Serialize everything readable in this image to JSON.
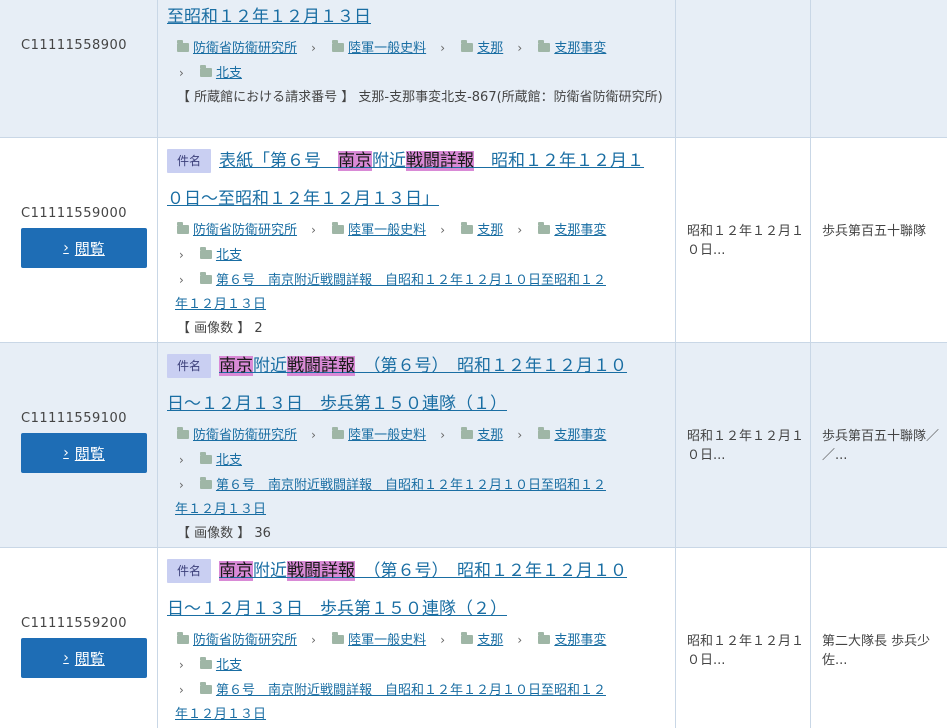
{
  "rows": [
    {
      "ref": "C11111558900",
      "title_lines": [
        "至昭和１２年１２月１３日"
      ],
      "crumbs": [
        "防衛省防衛研究所",
        "陸軍一般史料",
        "支那",
        "支那事変",
        "北支"
      ],
      "meta": "【 所蔵館における請求番号 】 支那-支那事変北支-867(所蔵館：防衛省防衛研究所)"
    },
    {
      "ref": "C11111559000",
      "badge": "件名",
      "view_label": "閲覧",
      "title": {
        "pre": "表紙「第６号　",
        "h1": "南京",
        "mid": "附近",
        "h2": "戦闘詳報",
        "post1": "　昭和１２年１２月１",
        "line2": "０日～至昭和１２年１２月１３日」"
      },
      "crumbs": [
        "防衛省防衛研究所",
        "陸軍一般史料",
        "支那",
        "支那事変",
        "北支"
      ],
      "crumb_last_1": "第６号　南京附近戦闘詳報　自昭和１２年１２月１０日至昭和１２",
      "crumb_last_2": "年１２月１３日",
      "meta": "【 画像数 】 2",
      "date": "昭和１２年１２月１０日...",
      "org": "歩兵第百五十聯隊"
    },
    {
      "ref": "C11111559100",
      "badge": "件名",
      "view_label": "閲覧",
      "title": {
        "pre": "",
        "h1": "南京",
        "mid": "附近",
        "h2": "戦闘詳報",
        "post1": "　（第６号）　昭和１２年１２月１０",
        "line2": "日～１２月１３日　歩兵第１５０連隊（１）"
      },
      "crumbs": [
        "防衛省防衛研究所",
        "陸軍一般史料",
        "支那",
        "支那事変",
        "北支"
      ],
      "crumb_last_1": "第６号　南京附近戦闘詳報　自昭和１２年１２月１０日至昭和１２",
      "crumb_last_2": "年１２月１３日",
      "meta": "【 画像数 】 36",
      "date": "昭和１２年１２月１０日...",
      "org": "歩兵第百五十聯隊／／..."
    },
    {
      "ref": "C11111559200",
      "badge": "件名",
      "view_label": "閲覧",
      "title": {
        "pre": "",
        "h1": "南京",
        "mid": "附近",
        "h2": "戦闘詳報",
        "post1": "　（第６号）　昭和１２年１２月１０",
        "line2": "日～１２月１３日　歩兵第１５０連隊（２）"
      },
      "crumbs": [
        "防衛省防衛研究所",
        "陸軍一般史料",
        "支那",
        "支那事変",
        "北支"
      ],
      "crumb_last_1": "第６号　南京附近戦闘詳報　自昭和１２年１２月１０日至昭和１２",
      "crumb_last_2": "年１２月１３日",
      "date": "昭和１２年１２月１０日...",
      "org": "第二大隊長 歩兵少佐..."
    }
  ],
  "colors": {
    "accent": "#1e6db5",
    "link": "#1a6ea3",
    "highlight": "#d98ad6",
    "badge": "#c9cff2",
    "shade": "#e7eef6"
  },
  "icons": {
    "folder": "folder-icon",
    "chevron": "chevron-right-icon"
  }
}
